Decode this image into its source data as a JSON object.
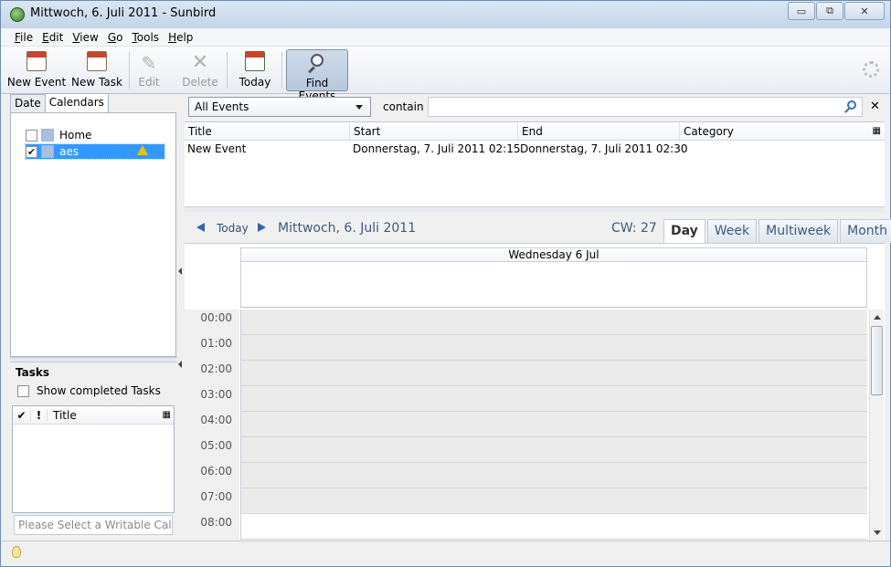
{
  "window": {
    "title": "Mittwoch, 6. Juli 2011 - Sunbird",
    "minimize_icon": "▭",
    "maximize_icon": "⧉",
    "close_icon": "✕"
  },
  "menu": [
    {
      "label": "File",
      "u": "F",
      "rest": "ile"
    },
    {
      "label": "Edit",
      "u": "E",
      "rest": "dit"
    },
    {
      "label": "View",
      "u": "V",
      "rest": "iew"
    },
    {
      "label": "Go",
      "u": "G",
      "rest": "o"
    },
    {
      "label": "Tools",
      "u": "T",
      "rest": "ools"
    },
    {
      "label": "Help",
      "u": "H",
      "rest": "elp"
    }
  ],
  "toolbar": {
    "new_event": "New Event",
    "new_task": "New Task",
    "edit": "Edit",
    "delete": "Delete",
    "today": "Today",
    "find_events": "Find Events"
  },
  "left": {
    "tabs": [
      "Date",
      "Calendars"
    ],
    "calendars": [
      {
        "name": "Home",
        "checked": false
      },
      {
        "name": "aes",
        "checked": true,
        "warning": true
      }
    ],
    "tasks_title": "Tasks",
    "show_completed": "Show completed Tasks",
    "task_columns": {
      "check": "✔",
      "priority": "!",
      "title": "Title"
    },
    "task_placeholder": "Please Select a Writable Calendar"
  },
  "filter": {
    "selected": "All Events",
    "contain_label": "contain",
    "search_value": "",
    "close": "✕"
  },
  "event_list": {
    "columns": [
      "Title",
      "Start",
      "End",
      "Category"
    ],
    "rows": [
      {
        "title": "New Event",
        "start": "Donnerstag, 7. Juli 2011 02:15",
        "end": "Donnerstag, 7. Juli 2011 02:30",
        "category": ""
      }
    ]
  },
  "nav": {
    "today": "Today",
    "date": "Mittwoch, 6. Juli 2011",
    "cw": "CW: 27",
    "views": [
      "Day",
      "Week",
      "Multiweek",
      "Month"
    ],
    "selected_view": "Day"
  },
  "dayview": {
    "header": "Wednesday 6 Jul",
    "hours": [
      "00:00",
      "01:00",
      "02:00",
      "03:00",
      "04:00",
      "05:00",
      "06:00",
      "07:00",
      "08:00"
    ]
  }
}
